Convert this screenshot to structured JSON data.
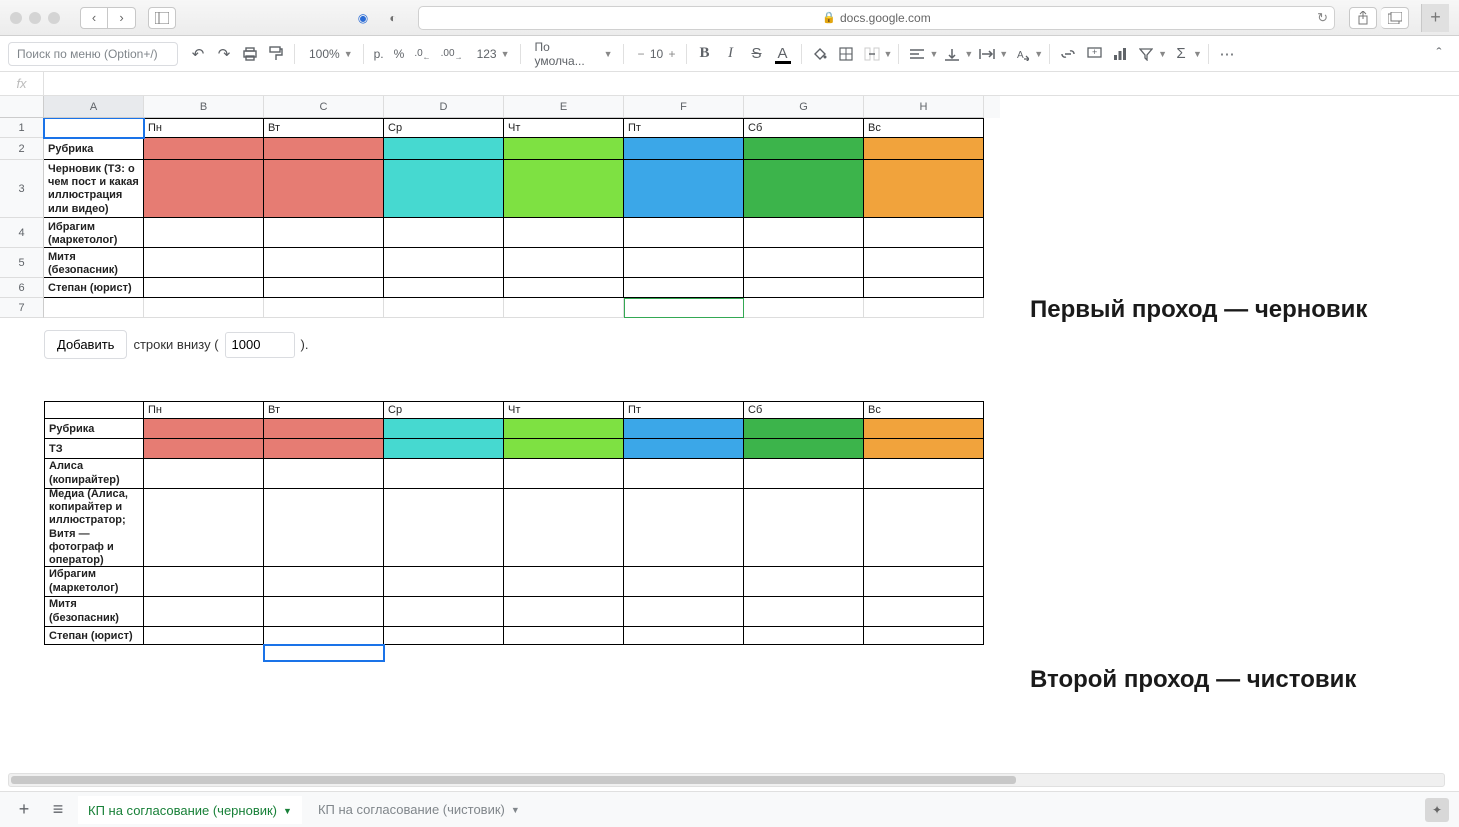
{
  "browser": {
    "url": "docs.google.com"
  },
  "toolbar": {
    "menu_search_placeholder": "Поиск по меню (Option+/)",
    "zoom": "100%",
    "currency": "р.",
    "percent": "%",
    "dec_dec": ".0",
    "dec_inc": ".00",
    "num_format": "123",
    "font": "По умолча...",
    "font_size": "10"
  },
  "columns": [
    "A",
    "B",
    "C",
    "D",
    "E",
    "F",
    "G",
    "H"
  ],
  "row_numbers": [
    "1",
    "2",
    "3",
    "4",
    "5",
    "6",
    "7"
  ],
  "days": [
    "Пн",
    "Вт",
    "Ср",
    "Чт",
    "Пт",
    "Сб",
    "Вс"
  ],
  "table1": {
    "rows": [
      "Рубрика",
      "Черновик (ТЗ: о чем пост и какая иллюстрация или видео)",
      "Ибрагим (маркетолог)",
      "Митя (безопасник)",
      "Степан (юрист)"
    ]
  },
  "add_rows": {
    "button": "Добавить",
    "label_before": "строки внизу (",
    "value": "1000",
    "label_after": ")."
  },
  "table2": {
    "rows": [
      "Рубрика",
      "ТЗ",
      "Алиса (копирайтер)",
      "Медиа (Алиса, копирайтер и иллюстратор; Витя — фотограф и оператор)",
      "Ибрагим (маркетолог)",
      "Митя (безопасник)",
      "Степан (юрист)"
    ]
  },
  "annotations": {
    "a1": "Первый проход — черновик",
    "a2": "Второй проход — чистовик"
  },
  "sheet_tabs": {
    "active": "КП на согласование (черновик)",
    "inactive": "КП на согласование (чистовик)"
  },
  "colors": {
    "red": "#e67c73",
    "cyan": "#46d9d0",
    "lime": "#7ee142",
    "blue": "#3ba7e8",
    "green": "#3cb44b",
    "orange": "#f1a33c"
  }
}
